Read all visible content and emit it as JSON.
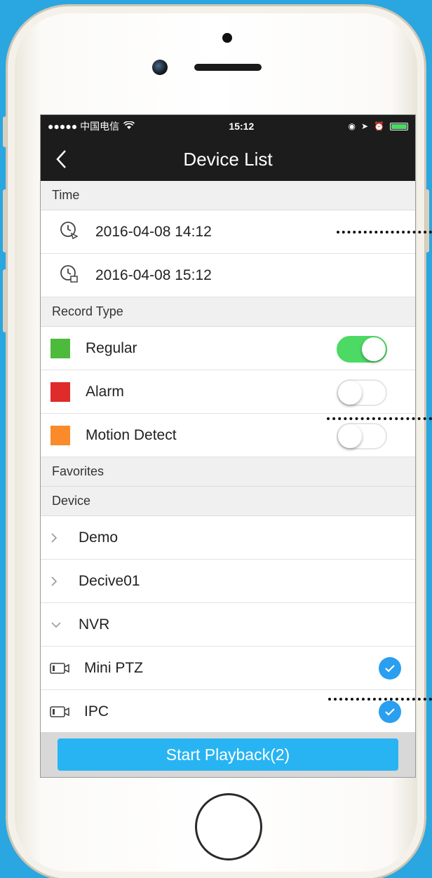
{
  "status_bar": {
    "carrier": "●●●●● 中国电信",
    "time": "15:12"
  },
  "nav": {
    "title": "Device List",
    "back_icon": "chevron-left-icon"
  },
  "sections": {
    "time": "Time",
    "record_type": "Record Type",
    "favorites": "Favorites",
    "device": "Device"
  },
  "time_rows": [
    {
      "label": "2016-04-08 14:12",
      "icon": "clock-start-icon"
    },
    {
      "label": "2016-04-08 15:12",
      "icon": "clock-end-icon"
    }
  ],
  "record_types": [
    {
      "label": "Regular",
      "color": "#4cbb3c",
      "enabled": true
    },
    {
      "label": "Alarm",
      "color": "#e02b2b",
      "enabled": false
    },
    {
      "label": "Motion Detect",
      "color": "#fb8a2a",
      "enabled": false
    }
  ],
  "devices": [
    {
      "label": "Demo",
      "expanded": false
    },
    {
      "label": "Decive01",
      "expanded": false
    },
    {
      "label": "NVR",
      "expanded": true
    }
  ],
  "channels": [
    {
      "label": "Mini PTZ",
      "checked": true
    },
    {
      "label": "IPC",
      "checked": true
    }
  ],
  "footer": {
    "button_label": "Start Playback(2)"
  },
  "colors": {
    "accent": "#28b4f2",
    "toggle_on": "#4cd964",
    "background": "#2aa6e0"
  }
}
